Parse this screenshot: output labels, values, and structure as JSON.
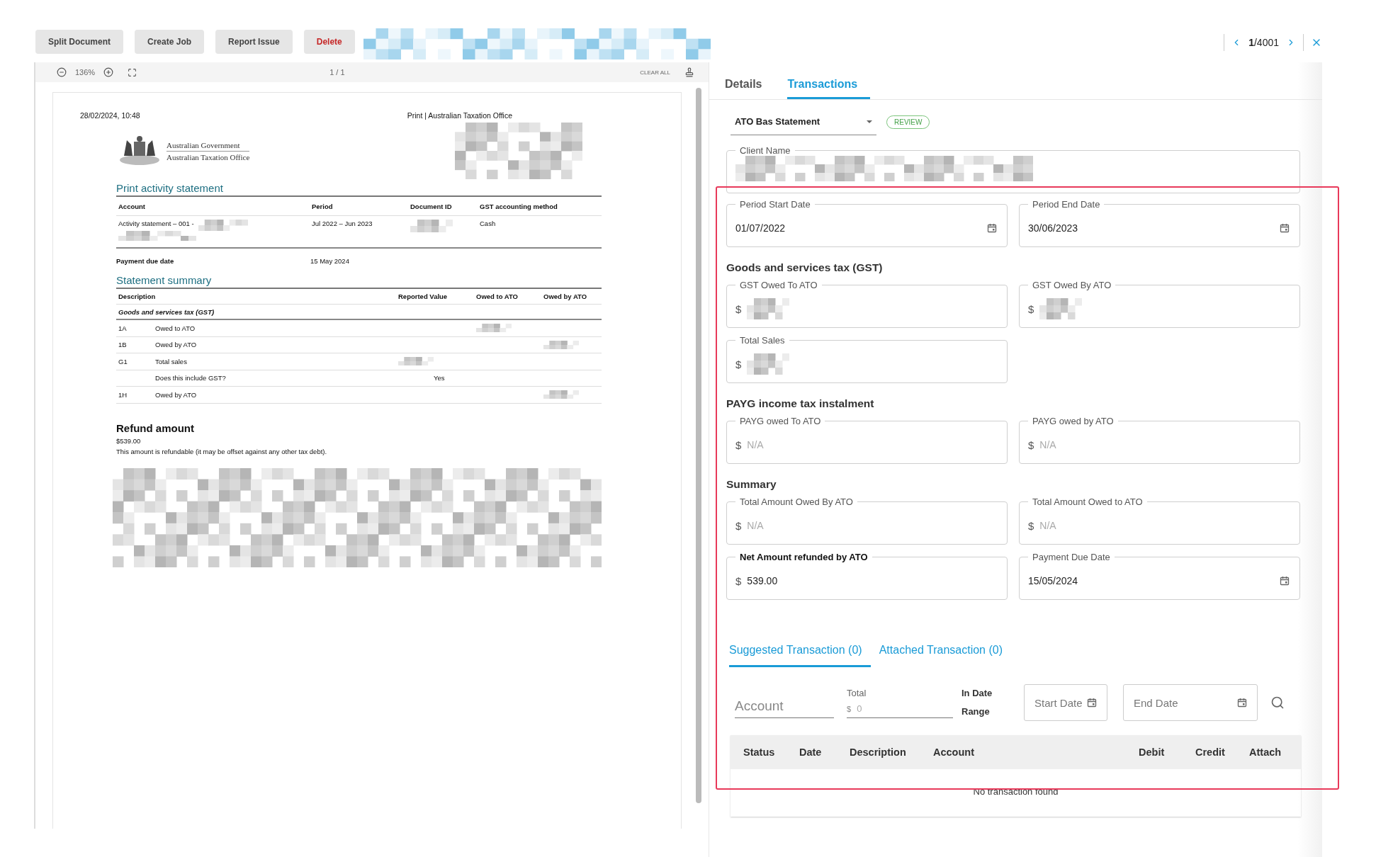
{
  "toolbar": {
    "buttons": [
      {
        "label": "Split Document",
        "kind": "normal"
      },
      {
        "label": "Create Job",
        "kind": "normal"
      },
      {
        "label": "Report Issue",
        "kind": "normal"
      },
      {
        "label": "Delete",
        "kind": "danger"
      }
    ]
  },
  "pager": {
    "current": "1",
    "total": "/4001"
  },
  "viewer": {
    "zoom": "136%",
    "page": "1 / 1",
    "clear": "CLEAR ALL"
  },
  "document": {
    "header_left": "28/02/2024, 10:48",
    "header_right": "Print | Australian Taxation Office",
    "agency": [
      "Australian Government",
      "Australian Taxation Office"
    ],
    "title": "Print activity statement",
    "account_columns": [
      "Account",
      "Period",
      "Document ID",
      "GST accounting method"
    ],
    "account_row": {
      "account": "Activity statement – 001 -",
      "period": "Jul 2022 – Jun 2023",
      "method": "Cash"
    },
    "payment_due": {
      "label": "Payment due date",
      "value": "15 May 2024"
    },
    "summary_title": "Statement summary",
    "summary_columns": [
      "Description",
      "Reported Value",
      "Owed to ATO",
      "Owed by ATO"
    ],
    "summary_group": "Goods and services tax (GST)",
    "summary_rows": [
      {
        "code": "1A",
        "label": "Owed to ATO",
        "owed_to_redacted": true
      },
      {
        "code": "1B",
        "label": "Owed by ATO",
        "owed_by_redacted": true
      },
      {
        "code": "G1",
        "label": "Total sales",
        "reported_redacted": true
      },
      {
        "label": "Does this include GST?",
        "reported": "Yes"
      },
      {
        "code": "1H",
        "label": "Owed by ATO",
        "owed_by_redacted": true
      }
    ],
    "refund": {
      "title": "Refund amount",
      "amount": "$539.00",
      "note": "This amount is refundable (it may be offset against any other tax debt)."
    }
  },
  "tabs": [
    {
      "label": "Details",
      "selected": false
    },
    {
      "label": "Transactions",
      "selected": true
    }
  ],
  "doc_type": {
    "value": "ATO Bas Statement",
    "status": "REVIEW"
  },
  "client_name": {
    "label": "Client Name",
    "redacted": true
  },
  "period": [
    {
      "label": "Period Start Date",
      "kind": "date",
      "value": "01/07/2022"
    },
    {
      "label": "Period End Date",
      "kind": "date",
      "value": "30/06/2023"
    }
  ],
  "sections": [
    {
      "heading": "Goods and services tax (GST)",
      "fields": [
        {
          "label": "GST Owed To ATO",
          "kind": "amount",
          "prefix": "$",
          "redacted": true
        },
        {
          "label": "GST Owed By ATO",
          "kind": "amount",
          "prefix": "$",
          "redacted": true
        },
        {
          "label": "Total Sales",
          "kind": "amount",
          "prefix": "$",
          "redacted": true
        }
      ]
    },
    {
      "heading": "PAYG income tax instalment",
      "fields": [
        {
          "label": "PAYG owed To ATO",
          "kind": "amount",
          "prefix": "$",
          "placeholder": "N/A"
        },
        {
          "label": "PAYG owed by ATO",
          "kind": "amount",
          "prefix": "$",
          "placeholder": "N/A"
        }
      ]
    },
    {
      "heading": "Summary",
      "fields": [
        {
          "label": "Total Amount Owed By ATO",
          "kind": "amount",
          "prefix": "$",
          "placeholder": "N/A"
        },
        {
          "label": "Total Amount Owed to ATO",
          "kind": "amount",
          "prefix": "$",
          "placeholder": "N/A"
        },
        {
          "label": "Net Amount refunded by ATO",
          "kind": "amount",
          "prefix": "$",
          "value": "539.00",
          "bold_label": true
        },
        {
          "label": "Payment Due Date",
          "kind": "date",
          "value": "15/05/2024"
        }
      ]
    }
  ],
  "sub_tabs": [
    {
      "label": "Suggested Transaction (0)",
      "selected": true
    },
    {
      "label": "Attached Transaction (0)",
      "selected": false
    }
  ],
  "filters": {
    "account_placeholder": "Account",
    "total_label": "Total",
    "total_prefix": "$",
    "total_placeholder": "0",
    "range_label": "In Date Range",
    "start_placeholder": "Start Date",
    "end_placeholder": "End Date"
  },
  "table": {
    "columns": [
      "Status",
      "Date",
      "Description",
      "Account",
      "Debit",
      "Credit",
      "Attach"
    ],
    "empty": "No transaction found"
  }
}
